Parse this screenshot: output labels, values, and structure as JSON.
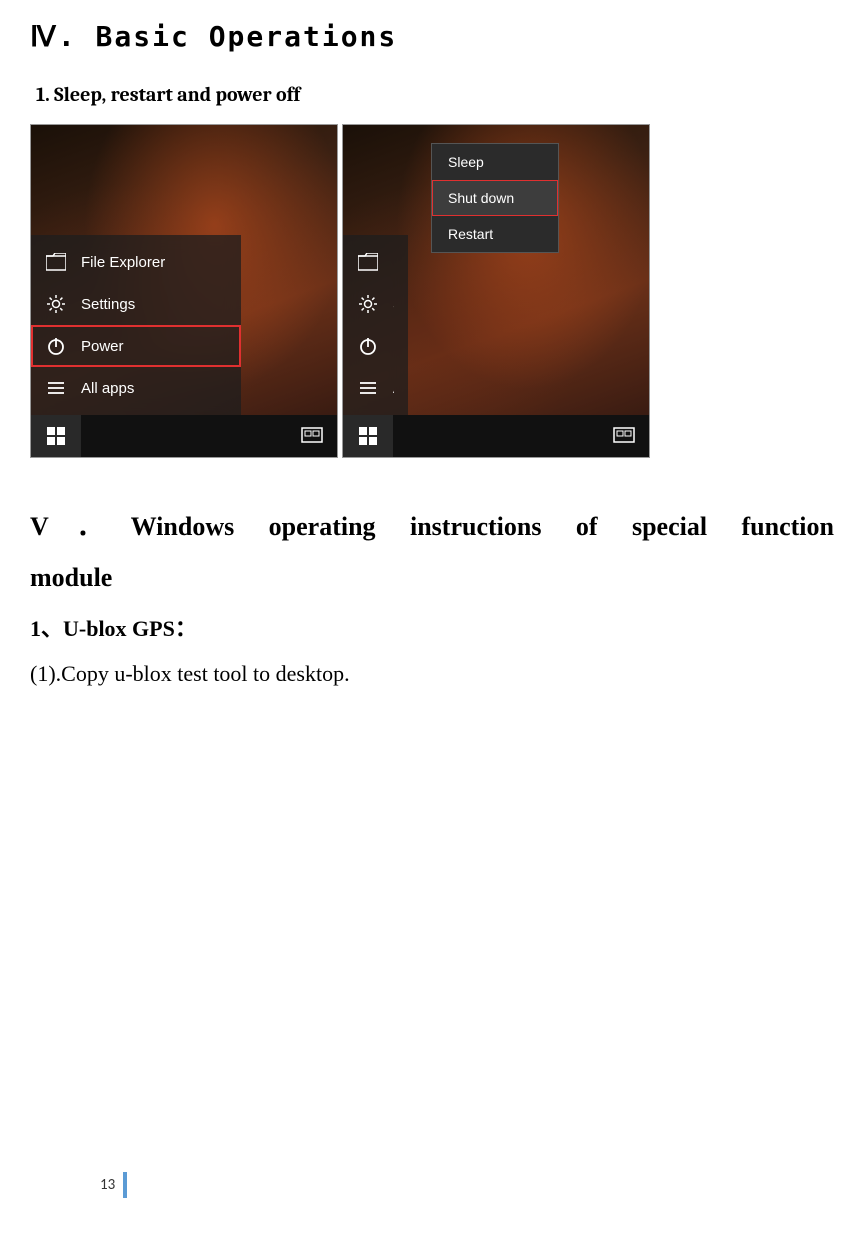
{
  "section4": {
    "heading": "Ⅳ. Basic Operations",
    "sub1": "1.   Sleep, restart and power off"
  },
  "screenshot1": {
    "items": {
      "file_explorer": "File Explorer",
      "settings": "Settings",
      "power": "Power",
      "all_apps": "All apps"
    }
  },
  "screenshot2": {
    "power_menu": {
      "sleep": "Sleep",
      "shut_down": "Shut down",
      "restart": "Restart"
    },
    "items": {
      "file": "File",
      "se": "Se",
      "power": "Power",
      "all_apps": "All apps"
    }
  },
  "section5": {
    "heading_line1": "V．Windows operating instructions of special function",
    "heading_line2": "module",
    "sub1": "1、U-blox    GPS：",
    "body1": "(1).Copy u-blox test tool to desktop."
  },
  "footer": {
    "page": "13"
  }
}
